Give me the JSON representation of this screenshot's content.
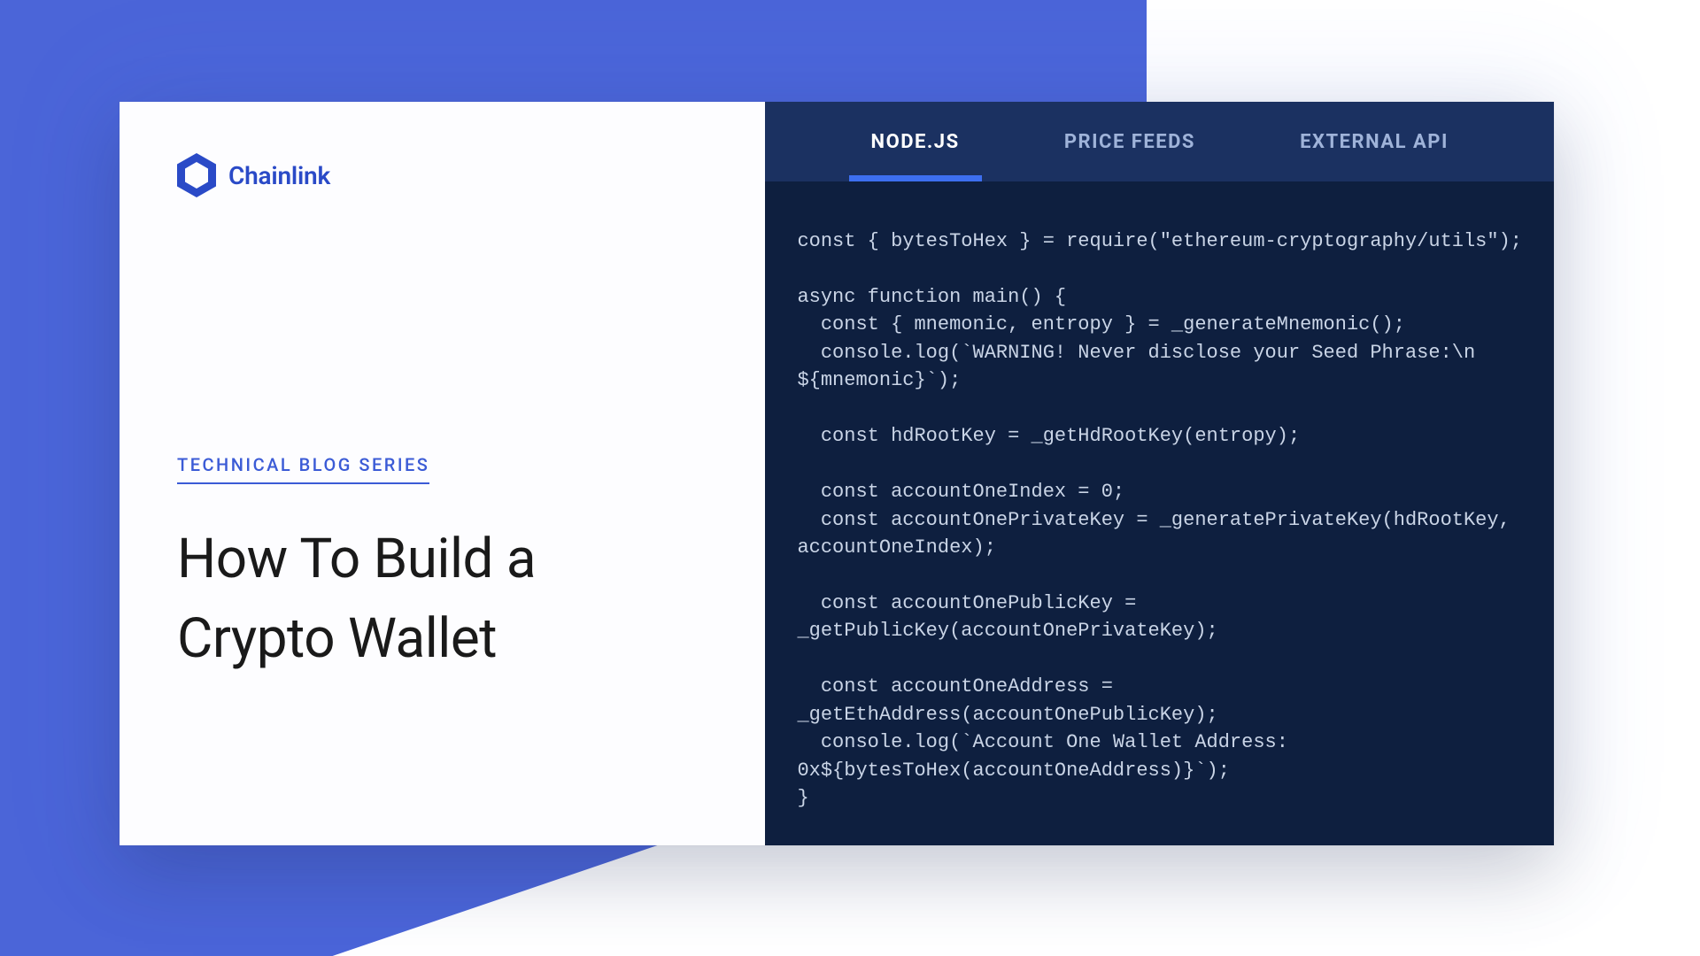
{
  "brand": {
    "name": "Chainlink",
    "color": "#2a4ac7"
  },
  "left": {
    "series_label": "TECHNICAL BLOG SERIES",
    "title_line1": "How To Build a",
    "title_line2": "Crypto Wallet"
  },
  "tabs": [
    {
      "label": "NODE.JS",
      "active": true
    },
    {
      "label": "PRICE FEEDS",
      "active": false
    },
    {
      "label": "EXTERNAL API",
      "active": false
    }
  ],
  "code": "const { bytesToHex } = require(\"ethereum-cryptography/utils\");\n\nasync function main() {\n  const { mnemonic, entropy } = _generateMnemonic();\n  console.log(`WARNING! Never disclose your Seed Phrase:\\n \n${mnemonic}`);\n\n  const hdRootKey = _getHdRootKey(entropy);\n\n  const accountOneIndex = 0;\n  const accountOnePrivateKey = _generatePrivateKey(hdRootKey, \naccountOneIndex);\n\n  const accountOnePublicKey = \n_getPublicKey(accountOnePrivateKey);\n\n  const accountOneAddress = \n_getEthAddress(accountOnePublicKey);\n  console.log(`Account One Wallet Address: \n0x${bytesToHex(accountOneAddress)}`);\n}"
}
